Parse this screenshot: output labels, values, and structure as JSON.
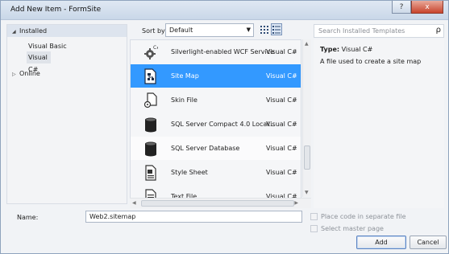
{
  "window": {
    "title": "Add New Item - FormSite",
    "minimize_glyph": "?",
    "close_glyph": "x"
  },
  "left_panel": {
    "installed_label": "Installed",
    "languages": [
      "Visual Basic",
      "Visual C#"
    ],
    "selected_language": "Visual C#",
    "online_label": "Online"
  },
  "toolbar": {
    "sort_label": "Sort by:",
    "sort_value": "Default",
    "view_icons": [
      "medium-icons-view-icon",
      "list-view-icon"
    ]
  },
  "templates": [
    {
      "name": "Silverlight-enabled WCF Service",
      "lang": "Visual C#",
      "icon": "wcf-service-icon"
    },
    {
      "name": "Site Map",
      "lang": "Visual C#",
      "icon": "site-map-icon",
      "selected": true
    },
    {
      "name": "Skin File",
      "lang": "Visual C#",
      "icon": "skin-file-icon"
    },
    {
      "name": "SQL Server Compact 4.0 Local...",
      "lang": "Visual C#",
      "icon": "database-icon"
    },
    {
      "name": "SQL Server Database",
      "lang": "Visual C#",
      "icon": "database-icon"
    },
    {
      "name": "Style Sheet",
      "lang": "Visual C#",
      "icon": "style-sheet-icon"
    },
    {
      "name": "Text File",
      "lang": "Visual C#",
      "icon": "text-file-icon"
    }
  ],
  "search": {
    "placeholder": "Search Installed Templates",
    "icon": "search-icon"
  },
  "details": {
    "type_label": "Type:",
    "type_value": "Visual C#",
    "description": "A file used to create a site map"
  },
  "form": {
    "name_label": "Name:",
    "name_value": "Web2.sitemap",
    "place_code_label": "Place code in separate file",
    "select_master_label": "Select master page",
    "add_label": "Add",
    "cancel_label": "Cancel"
  },
  "colors": {
    "selection": "#3399ff",
    "title_bar": "#c9d7e8",
    "close_button": "#c8442c"
  }
}
